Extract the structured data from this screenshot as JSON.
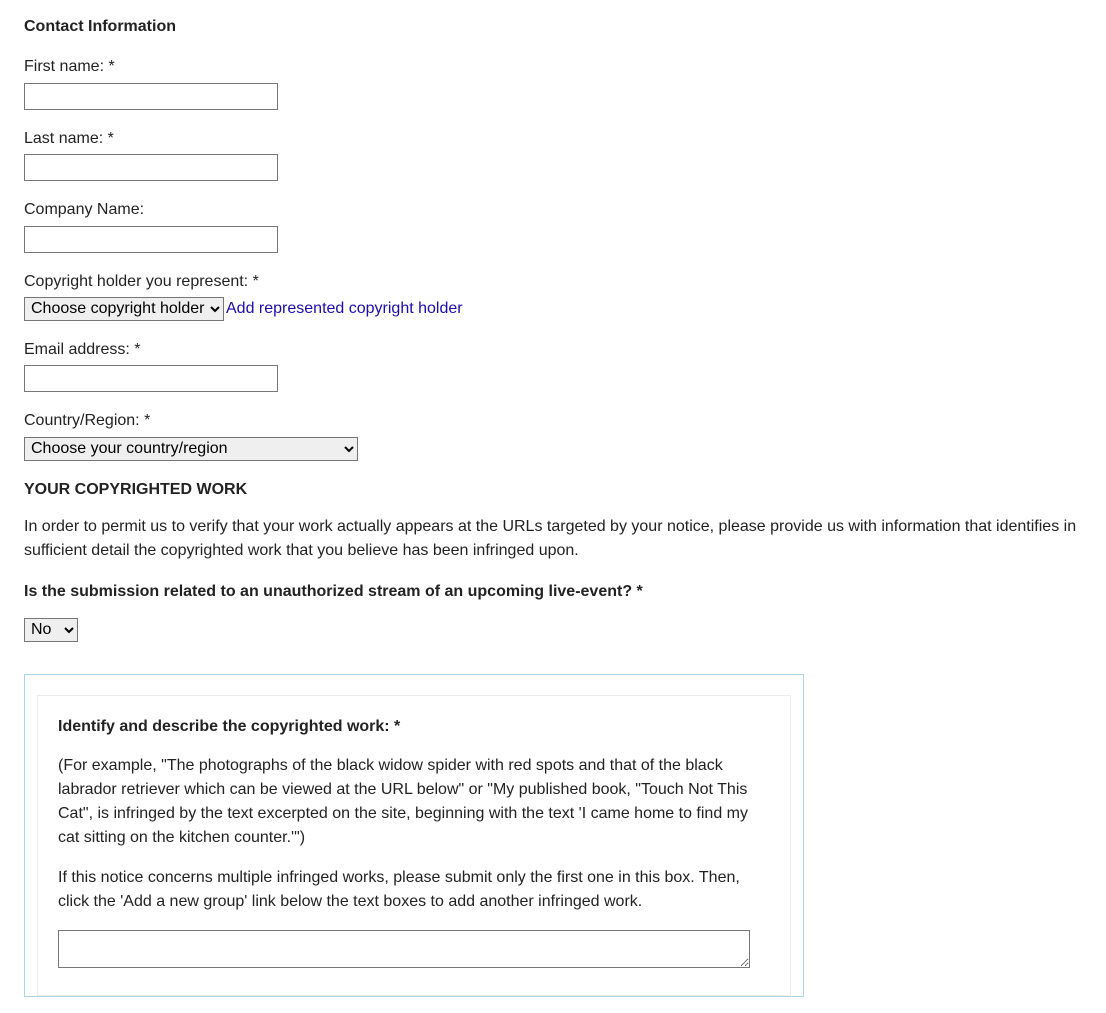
{
  "contact": {
    "heading": "Contact Information",
    "first_name_label": "First name: *",
    "first_name_value": "",
    "last_name_label": "Last name: *",
    "last_name_value": "",
    "company_label": "Company Name:",
    "company_value": "",
    "copyright_holder_label": "Copyright holder you represent: *",
    "copyright_holder_selected": "Choose copyright holder",
    "add_holder_link": "Add represented copyright holder",
    "email_label": "Email address: *",
    "email_value": "",
    "country_label": "Country/Region: *",
    "country_selected": "Choose your country/region"
  },
  "work": {
    "heading": "YOUR COPYRIGHTED WORK",
    "description": "In order to permit us to verify that your work actually appears at the URLs targeted by your notice, please provide us with information that identifies in sufficient detail the copyrighted work that you believe has been infringed upon.",
    "live_event_question": "Is the submission related to an unauthorized stream of an upcoming live-event? *",
    "live_event_selected": "No"
  },
  "identify": {
    "heading": "Identify and describe the copyrighted work: *",
    "example_text": "(For example, \"The photographs of the black widow spider with red spots and that of the black labrador retriever which can be viewed at the URL below\" or \"My published book, \"Touch Not This Cat\", is infringed by the text excerpted on the site, beginning with the text 'I came home to find my cat sitting on the kitchen counter.'\")",
    "multiple_text": "If this notice concerns multiple infringed works, please submit only the first one in this box. Then, click the 'Add a new group' link below the text boxes to add another infringed work.",
    "textarea_value": ""
  }
}
